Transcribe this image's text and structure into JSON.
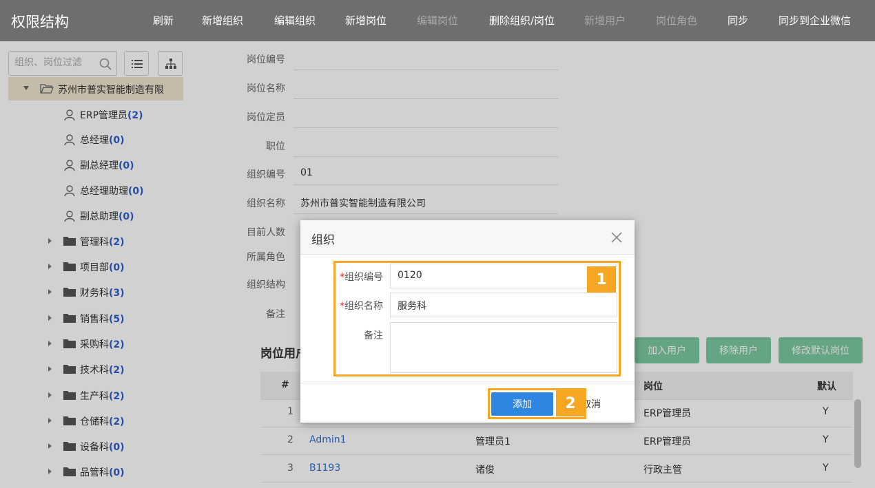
{
  "header": {
    "title": "权限结构",
    "nav": [
      {
        "label": "刷新",
        "enabled": true
      },
      {
        "label": "新增组织",
        "enabled": true
      },
      {
        "label": "编辑组织",
        "enabled": true
      },
      {
        "label": "新增岗位",
        "enabled": true
      },
      {
        "label": "编辑岗位",
        "enabled": false
      },
      {
        "label": "删除组织/岗位",
        "enabled": true
      },
      {
        "label": "新增用户",
        "enabled": false
      },
      {
        "label": "岗位角色",
        "enabled": false
      },
      {
        "label": "同步",
        "enabled": true
      },
      {
        "label": "同步到企业微信",
        "enabled": true
      }
    ]
  },
  "sidebar": {
    "search_placeholder": "组织、岗位过滤",
    "icons": [
      "search-icon",
      "list-icon",
      "org-tree-icon"
    ],
    "root": {
      "label": "苏州市普实智能制造有限"
    },
    "roles": [
      {
        "name": "ERP管理员",
        "count": "(2)"
      },
      {
        "name": "总经理",
        "count": "(0)"
      },
      {
        "name": "副总经理",
        "count": "(0)"
      },
      {
        "name": "总经理助理",
        "count": "(0)"
      },
      {
        "name": "副总助理",
        "count": "(0)"
      }
    ],
    "departments": [
      {
        "name": "管理科",
        "count": "(2)"
      },
      {
        "name": "项目部",
        "count": "(0)"
      },
      {
        "name": "财务科",
        "count": "(3)"
      },
      {
        "name": "销售科",
        "count": "(5)"
      },
      {
        "name": "采购科",
        "count": "(2)"
      },
      {
        "name": "技术科",
        "count": "(2)"
      },
      {
        "name": "生产科",
        "count": "(2)"
      },
      {
        "name": "仓储科",
        "count": "(2)"
      },
      {
        "name": "设备科",
        "count": "(0)"
      },
      {
        "name": "品管科",
        "count": "(0)"
      }
    ]
  },
  "form": {
    "position_code": {
      "label": "岗位编号",
      "value": ""
    },
    "position_name": {
      "label": "岗位名称",
      "value": ""
    },
    "position_quota": {
      "label": "岗位定员",
      "value": ""
    },
    "job_level": {
      "label": "职位",
      "value": ""
    },
    "org_code": {
      "label": "组织编号",
      "value": "01"
    },
    "org_name": {
      "label": "组织名称",
      "value": "苏州市普实智能制造有限公司"
    },
    "headcount": {
      "label": "目前人数"
    },
    "roles": {
      "label": "所属角色"
    },
    "org_structure": {
      "label": "组织结构"
    },
    "remark": {
      "label": "备注"
    }
  },
  "users_section": {
    "title": "岗位用户",
    "buttons": {
      "add_user": "加入用户",
      "remove_user": "移除用户",
      "set_default": "修改默认岗位"
    },
    "columns": {
      "index": "#",
      "position": "岗位",
      "default": "默认"
    },
    "rows": [
      {
        "index": "1",
        "code": "",
        "name": "",
        "position": "ERP管理员",
        "default": "Y"
      },
      {
        "index": "2",
        "code": "Admin1",
        "name": "管理员1",
        "position": "ERP管理员",
        "default": "Y"
      },
      {
        "index": "3",
        "code": "B1193",
        "name": "诸俊",
        "position": "行政主管",
        "default": "Y"
      }
    ]
  },
  "modal": {
    "title": "组织",
    "fields": {
      "code": {
        "label": "组织编号",
        "required_mark": "*",
        "value": "0120"
      },
      "name": {
        "label": "组织名称",
        "required_mark": "*",
        "value": "服务科"
      },
      "remark": {
        "label": "备注",
        "value": ""
      }
    },
    "add_label": "添加",
    "cancel_label": "取消",
    "badges": {
      "one": "1",
      "two": "2"
    }
  },
  "colors": {
    "header_bg": "#6e6e6e",
    "accent_blue": "#2f86e0",
    "highlight_orange": "#f5a623",
    "green_button": "#7ccaa2",
    "selected_node_bg": "#f1e5d0"
  }
}
